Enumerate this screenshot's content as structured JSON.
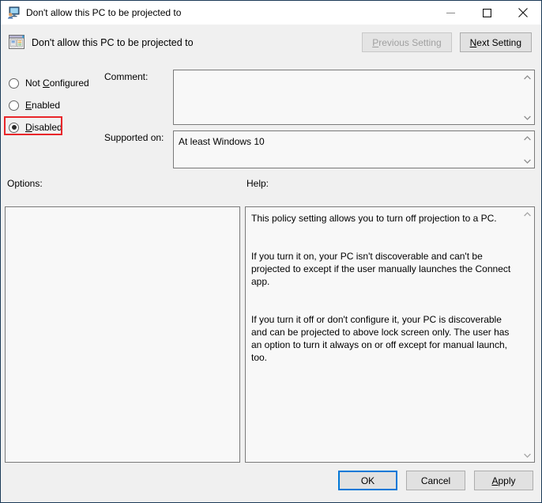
{
  "titlebar": {
    "title": "Don't allow this PC to be projected to",
    "icon": "remote-desktop-icon",
    "minimize_label": "Minimize",
    "maximize_label": "Maximize",
    "close_label": "Close"
  },
  "header": {
    "icon": "policy-setting-icon",
    "title": "Don't allow this PC to be projected to",
    "previous_setting_mnemonic": "P",
    "previous_setting_rest": "revious Setting",
    "next_setting_mnemonic": "N",
    "next_setting_rest": "ext Setting"
  },
  "state_options": [
    {
      "label_pre": "Not ",
      "mnemonic": "C",
      "label_post": "onfigured",
      "selected": false,
      "highlighted": false
    },
    {
      "label_pre": "",
      "mnemonic": "E",
      "label_post": "nabled",
      "selected": false,
      "highlighted": false
    },
    {
      "label_pre": "",
      "mnemonic": "D",
      "label_post": "isabled",
      "selected": true,
      "highlighted": true
    }
  ],
  "comment": {
    "label": "Comment:",
    "value": "",
    "placeholder": ""
  },
  "supported_on": {
    "label": "Supported on:",
    "value": "At least Windows 10"
  },
  "options": {
    "label": "Options:",
    "content": ""
  },
  "help": {
    "label": "Help:",
    "paragraph1": "This policy setting allows you to turn off projection to a PC.",
    "paragraph2": "If you turn it on, your PC isn't discoverable and can't be projected to except if the user manually launches the Connect app.",
    "paragraph3": "If you turn it off or don't configure it, your PC is discoverable and can be projected to above lock screen only. The user has an option to turn it always on or off except for manual launch, too."
  },
  "footer": {
    "ok_label": "OK",
    "cancel_label": "Cancel",
    "apply_mnemonic": "A",
    "apply_rest": "pply"
  },
  "colors": {
    "highlight_red": "#e8262a",
    "focus_blue": "#0078d7",
    "dialog_background": "#f0f0f0",
    "field_background": "#f8f8f8",
    "title_border": "#1b3a57"
  }
}
